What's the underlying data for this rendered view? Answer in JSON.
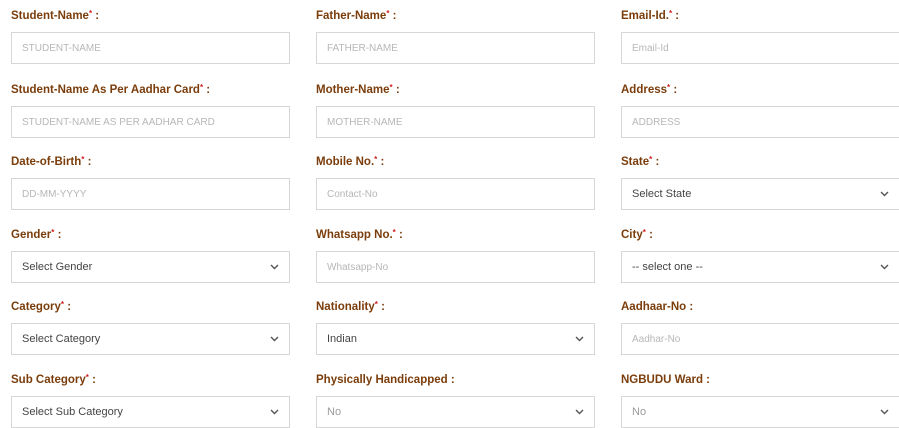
{
  "col1": {
    "student_name": {
      "label": "Student-Name",
      "placeholder": "STUDENT-NAME"
    },
    "aadhar_name": {
      "label": "Student-Name As Per Aadhar Card",
      "placeholder": "STUDENT-NAME AS PER AADHAR CARD"
    },
    "dob": {
      "label": "Date-of-Birth",
      "placeholder": "DD-MM-YYYY"
    },
    "gender": {
      "label": "Gender",
      "value": "Select Gender"
    },
    "category": {
      "label": "Category",
      "value": "Select Category"
    },
    "sub_category": {
      "label": "Sub Category",
      "value": "Select Sub Category"
    }
  },
  "col2": {
    "father_name": {
      "label": "Father-Name",
      "placeholder": "FATHER-NAME"
    },
    "mother_name": {
      "label": "Mother-Name",
      "placeholder": "MOTHER-NAME"
    },
    "mobile": {
      "label": "Mobile No.",
      "placeholder": "Contact-No"
    },
    "whatsapp": {
      "label": "Whatsapp No.",
      "placeholder": "Whatsapp-No"
    },
    "nationality": {
      "label": "Nationality",
      "value": "Indian"
    },
    "physically_handicapped": {
      "label": "Physically Handicapped :",
      "value": "No"
    }
  },
  "col3": {
    "email": {
      "label": "Email-Id.",
      "placeholder": "Email-Id"
    },
    "address": {
      "label": "Address",
      "placeholder": "ADDRESS"
    },
    "state": {
      "label": "State",
      "value": "Select State"
    },
    "city": {
      "label": "City",
      "value": "-- select one --"
    },
    "aadhaar_no": {
      "label": "Aadhaar-No :",
      "placeholder": "Aadhar-No"
    },
    "ngbudu_ward": {
      "label": "NGBUDU Ward :",
      "value": "No"
    }
  },
  "marks": {
    "required": "*",
    "colon": ":"
  },
  "colors": {
    "label": "#7a3d0b",
    "required": "#d21f1f",
    "border": "#d6d6d6"
  }
}
